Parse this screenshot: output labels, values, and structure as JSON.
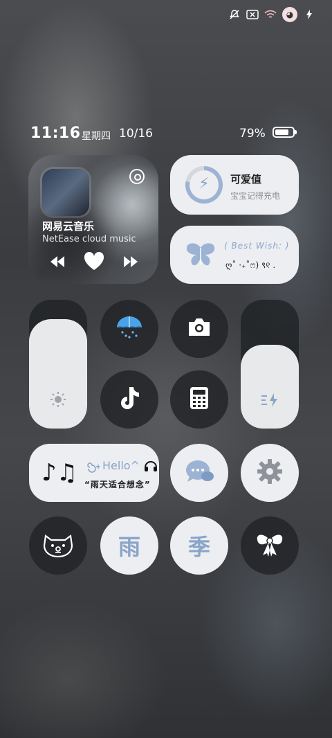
{
  "status_bar": {
    "icons": [
      "dnd-off-icon",
      "no-sim-icon",
      "wifi-icon",
      "avatar-icon",
      "charging-icon"
    ]
  },
  "header": {
    "time": "11:16",
    "weekday": "星期四",
    "date": "10/16",
    "battery_percent": "79%",
    "battery_level": 0.79
  },
  "music": {
    "title": "网易云音乐",
    "subtitle": "NetEase cloud music",
    "controls": [
      "previous-icon",
      "like-icon",
      "next-icon"
    ]
  },
  "battery_widget": {
    "title": "可爱值",
    "subtitle": "宝宝记得充电",
    "level": 0.78
  },
  "wish_widget": {
    "line1": "( Best Wish: )",
    "line2": "ღ˚ ·₊˚ෆ) ९୧ ."
  },
  "sliders": {
    "brightness_level": 0.85,
    "volume_level": 0.65
  },
  "hello_widget": {
    "notes": "♪♫",
    "line1": "Hello^",
    "line2": "“雨天适合想念”"
  },
  "tiles": {
    "rain_char": "雨",
    "season_char": "季"
  },
  "colors": {
    "accent": "#8aa4c8",
    "card": "#eceef1",
    "dark_tile": "#232528"
  }
}
